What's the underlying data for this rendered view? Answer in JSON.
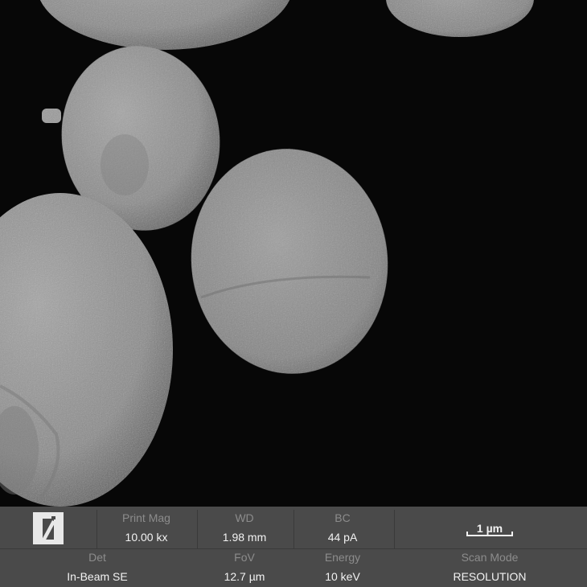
{
  "info_bar": {
    "print_mag": {
      "label": "Print Mag",
      "value": "10.00 kx"
    },
    "wd": {
      "label": "WD",
      "value": "1.98 mm"
    },
    "bc": {
      "label": "BC",
      "value": "44 pA"
    },
    "det": {
      "label": "Det",
      "value": "In-Beam SE"
    },
    "fov": {
      "label": "FoV",
      "value": "12.7 µm"
    },
    "energy": {
      "label": "Energy",
      "value": "10 keV"
    },
    "scan_mode": {
      "label": "Scan Mode",
      "value": "RESOLUTION"
    },
    "scale_bar": {
      "label": "1 µm"
    },
    "logo_icon": "logo-icon"
  },
  "colors": {
    "background": "#000000",
    "info_bar": "#4a4a4a",
    "label_text": "#8c8c8c",
    "value_text": "#f2f2f2",
    "particle": "#8a8a8a"
  }
}
